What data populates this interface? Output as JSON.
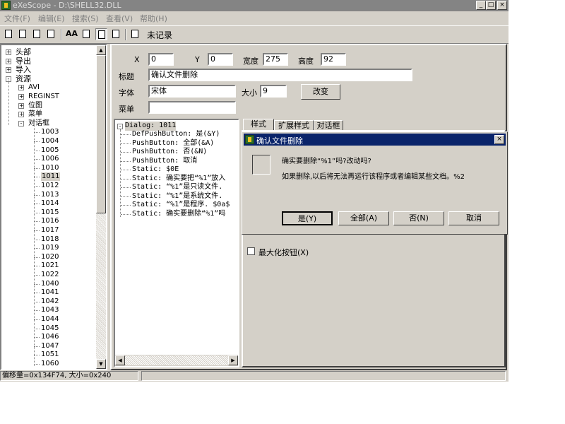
{
  "window": {
    "title": "eXeScope - D:\\SHELL32.DLL",
    "min_glyph": "_",
    "max_glyph": "□",
    "close_glyph": "×"
  },
  "menu": [
    "文件(F)",
    "编辑(E)",
    "搜索(S)",
    "查看(V)",
    "帮助(H)"
  ],
  "toolbar": {
    "status_text": "未记录",
    "aa_label": "AA",
    "icons": [
      "open-icon",
      "save-icon",
      "save-all-icon",
      "export-icon",
      "font-icon",
      "dialog-icon",
      "dialog-edit-icon",
      "dialog-view-icon",
      "bookmark-icon"
    ]
  },
  "tree": {
    "top_items": [
      {
        "label": "头部",
        "exp": "+"
      },
      {
        "label": "导出",
        "exp": "+"
      },
      {
        "label": "导入",
        "exp": "+"
      },
      {
        "label": "资源",
        "exp": "-"
      }
    ],
    "resource_children": [
      {
        "label": "AVI",
        "exp": "+"
      },
      {
        "label": "REGINST",
        "exp": "+"
      },
      {
        "label": "位图",
        "exp": "+"
      },
      {
        "label": "菜单",
        "exp": "+"
      },
      {
        "label": "对话框",
        "exp": "-"
      }
    ],
    "dialog_items": [
      "1003",
      "1004",
      "1005",
      "1006",
      "1010",
      "1011",
      "1012",
      "1013",
      "1014",
      "1015",
      "1016",
      "1017",
      "1018",
      "1019",
      "1020",
      "1021",
      "1022",
      "1040",
      "1041",
      "1042",
      "1043",
      "1044",
      "1045",
      "1046",
      "1047",
      "1051",
      "1060"
    ],
    "selected_item": "1011"
  },
  "props": {
    "x_label": "X",
    "x_value": "0",
    "y_label": "Y",
    "y_value": "0",
    "width_label": "宽度",
    "width_value": "275",
    "height_label": "高度",
    "height_value": "92",
    "caption_label": "标题",
    "caption_value": "确认文件删除",
    "font_label": "字体",
    "font_value": "宋体",
    "size_label": "大小",
    "size_value": "9",
    "change_button": "改变",
    "menu_label": "菜单",
    "menu_value": ""
  },
  "res_tree": {
    "root": "Dialog: 1011",
    "lines": [
      "DefPushButton: 是(&Y)",
      "PushButton: 全部(&A)",
      "PushButton: 否(&N)",
      "PushButton: 取消",
      "Static: $0E",
      "Static: 确实要把“%1”放入",
      "Static: “%1”是只读文件.",
      "Static: “%1”是系统文件.",
      "Static: “%1”是程序. $0a$",
      "Static: 确实要删除“%1”吗"
    ]
  },
  "tabs": [
    "样式",
    "扩展样式",
    "对话框"
  ],
  "style_options": [
    {
      "label": "最大化按钮(X)"
    }
  ],
  "preview_dialog": {
    "title": "确认文件删除",
    "close_glyph": "×",
    "line1": "确实要删除“%1”吗?改动吗?",
    "line2": "如果删除,以后将无法再运行该程序或者编辑某些文档。%2",
    "buttons": [
      "是(Y)",
      "全部(A)",
      "否(N)",
      "取消"
    ]
  },
  "statusbar": {
    "text": "偏移量=0x134F74, 大小=0x240"
  },
  "colors": {
    "face": "#d4d0c8",
    "active_title": "#0a246a",
    "inactive_title": "#848484",
    "selection": "#0a246a"
  }
}
